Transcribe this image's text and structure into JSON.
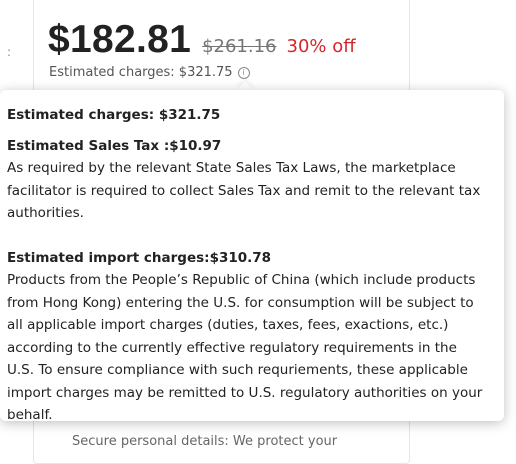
{
  "left_marker": ":",
  "price": {
    "current": "$182.81",
    "original": "$261.16",
    "discount": "30% off",
    "estimated_charges_label": "Estimated charges: $321.75"
  },
  "tooltip": {
    "title": "Estimated charges: $321.75",
    "sales_tax": {
      "heading": "Estimated Sales Tax :$10.97",
      "body": "As required by the relevant State Sales Tax Laws, the marketplace facilitator is required to collect Sales Tax and remit to the relevant tax authorities."
    },
    "import_charges": {
      "heading": "Estimated import charges:$310.78",
      "body": "Products from the People’s Republic of China (which include products from Hong Kong) entering the U.S. for consumption will be subject to all applicable import charges (duties, taxes, fees, exactions, etc.) according to the currently effective regulatory requirements in the U.S. To ensure compliance with such requriements, these applicable import charges may be remitted to U.S. regulatory authorities on your behalf."
    }
  },
  "secure_text": "Secure personal details: We protect your",
  "colors": {
    "discount": "#d5262b",
    "original_price": "#757575",
    "text": "#222222"
  },
  "icons": {
    "info": "info-circle-icon"
  }
}
